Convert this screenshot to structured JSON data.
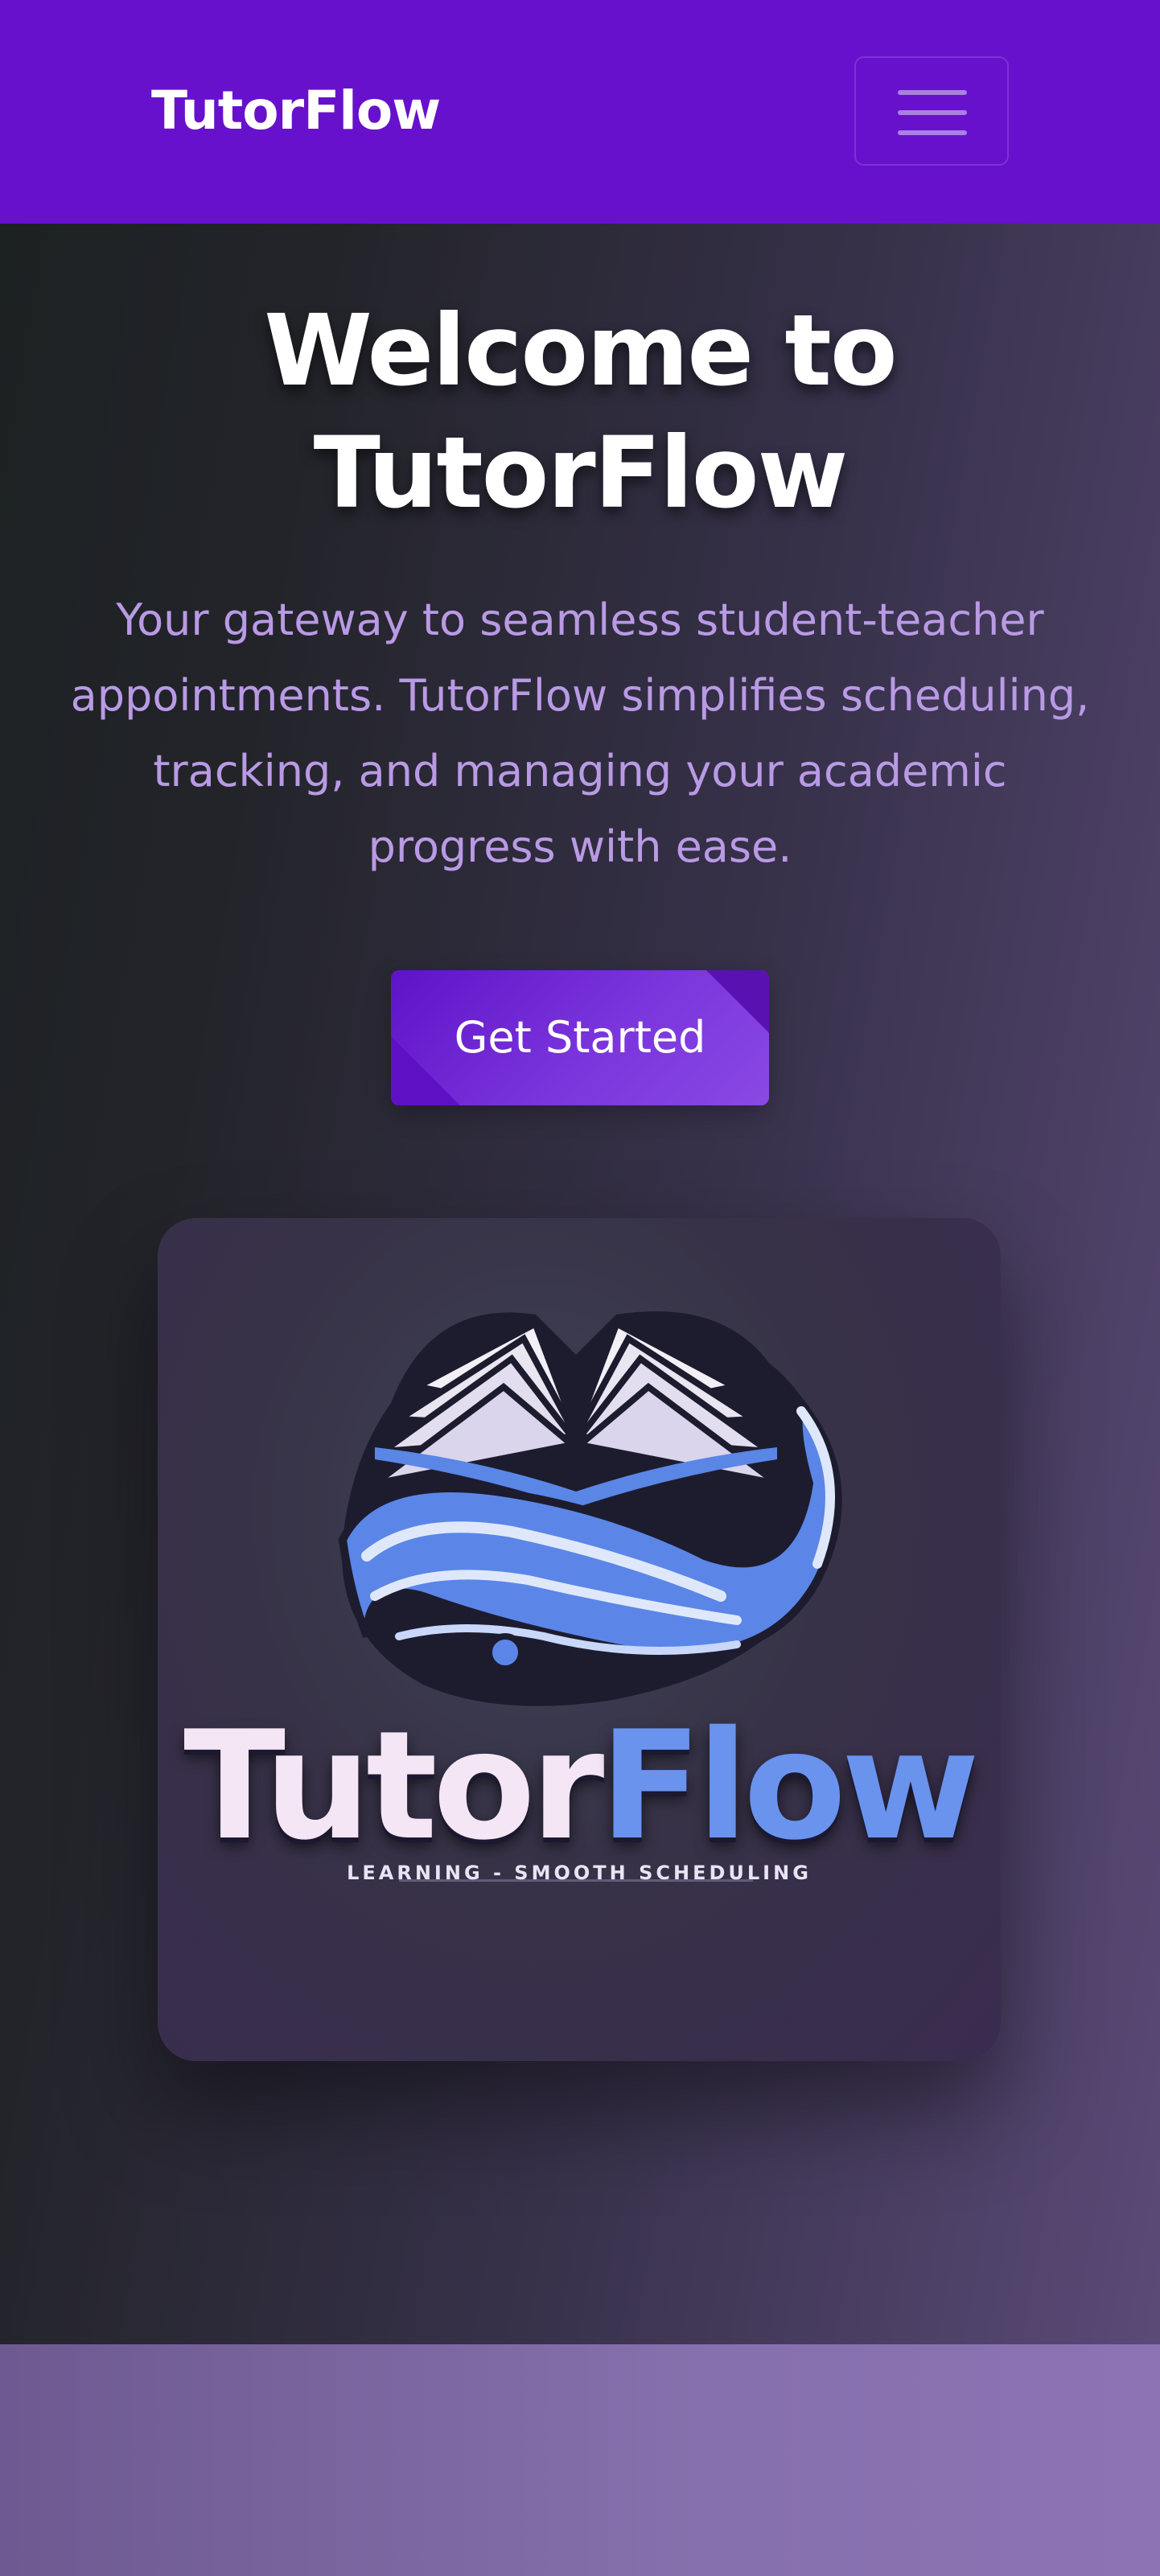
{
  "navbar": {
    "brand": "TutorFlow",
    "menu_icon": "hamburger-menu-icon"
  },
  "hero": {
    "title": "Welcome to TutorFlow",
    "description": "Your gateway to seamless student-teacher appointments. TutorFlow simplifies scheduling, tracking, and managing your academic progress with ease.",
    "cta_label": "Get Started"
  },
  "logo": {
    "word_part1": "Tutor",
    "word_part2": "Flow",
    "tagline": "LEARNING - SMOOTH SCHEDULING",
    "icon": "open-book-wave-icon"
  },
  "colors": {
    "navbar_bg": "#6711cc",
    "accent": "#7a35dc",
    "description_text": "#b99ae4",
    "logo_blue": "#6a93ee"
  }
}
